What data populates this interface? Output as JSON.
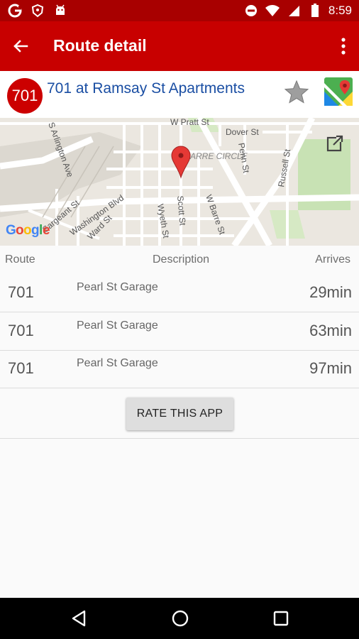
{
  "status_bar": {
    "time": "8:59",
    "icons_left": [
      "google-g-icon",
      "brave-shield-icon",
      "android-bot-icon"
    ],
    "icons_right": [
      "do-not-disturb-icon",
      "wifi-icon",
      "signal-icon",
      "battery-icon"
    ]
  },
  "app_bar": {
    "title": "Route detail",
    "back_icon": "arrow-back-icon",
    "menu_icon": "more-vert-icon"
  },
  "stop": {
    "route_number": "701",
    "name": "701 at Ramsay St Apartments",
    "favorite_icon": "star-icon",
    "maps_icon": "google-maps-icon"
  },
  "map": {
    "streets": [
      "W Pratt St",
      "Dover St",
      "BARRE CIRCLE",
      "Penn St",
      "Russell St",
      "S Arlington Ave",
      "Sargeant St",
      "Washington Blvd",
      "Ward St",
      "Wyeth St",
      "Scott St",
      "W Barre St"
    ],
    "logo": "Google",
    "open_external_icon": "open-in-new-icon"
  },
  "table": {
    "headers": {
      "route": "Route",
      "description": "Description",
      "arrives": "Arrives"
    },
    "rows": [
      {
        "route": "701",
        "description": "Pearl St Garage",
        "arrives": "29min"
      },
      {
        "route": "701",
        "description": "Pearl St Garage",
        "arrives": "63min"
      },
      {
        "route": "701",
        "description": "Pearl St Garage",
        "arrives": "97min"
      }
    ]
  },
  "rate_button": "RATE THIS APP",
  "nav_bar": {
    "back": "nav-back-icon",
    "home": "nav-home-icon",
    "recents": "nav-recents-icon"
  },
  "colors": {
    "status_bar": "#a80000",
    "app_bar": "#c80000",
    "route_badge": "#cc0000",
    "stop_name": "#1a4ea3"
  }
}
